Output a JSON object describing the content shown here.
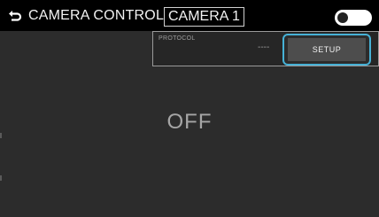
{
  "header": {
    "title": "CAMERA CONTROL",
    "camera_select": "CAMERA 1",
    "power_toggle_state": "off"
  },
  "protocol": {
    "label": "PROTOCOL",
    "value": "----"
  },
  "setup_button": {
    "label": "SETUP"
  },
  "status": {
    "text": "OFF"
  },
  "colors": {
    "accent_focus": "#46b1d6",
    "background": "#2c2c2c",
    "header": "#000000"
  }
}
